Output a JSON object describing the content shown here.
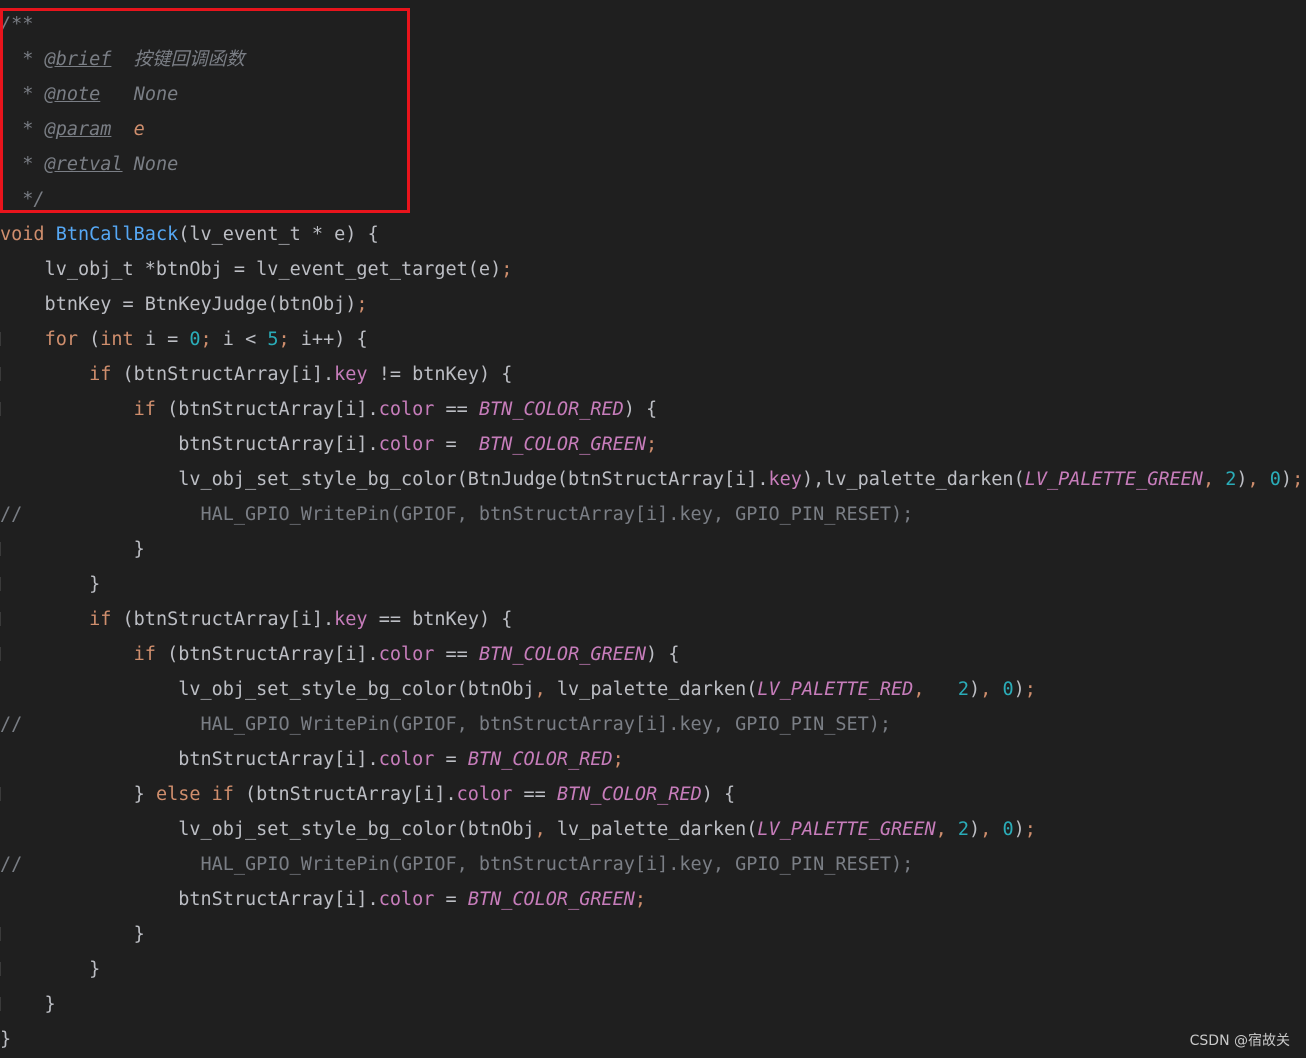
{
  "editor": {
    "lines": [
      {
        "guide": false,
        "tokens": [
          [
            "/**",
            "doc"
          ]
        ]
      },
      {
        "guide": false,
        "tokens": [
          [
            "  * ",
            "doc"
          ],
          [
            "@brief",
            "doctag"
          ],
          [
            "  ",
            "doc"
          ],
          [
            "按键回调函数",
            "doctext"
          ]
        ]
      },
      {
        "guide": false,
        "tokens": [
          [
            "  * ",
            "doc"
          ],
          [
            "@note",
            "doctag"
          ],
          [
            "   ",
            "doc"
          ],
          [
            "None",
            "doctext"
          ]
        ]
      },
      {
        "guide": false,
        "tokens": [
          [
            "  * ",
            "doc"
          ],
          [
            "@param",
            "doctag"
          ],
          [
            "  ",
            "doc"
          ],
          [
            "e",
            "docparam"
          ]
        ]
      },
      {
        "guide": false,
        "tokens": [
          [
            "  * ",
            "doc"
          ],
          [
            "@retval",
            "doctag"
          ],
          [
            " ",
            "doc"
          ],
          [
            "None",
            "doctext"
          ]
        ]
      },
      {
        "guide": false,
        "tokens": [
          [
            "  */",
            "doc"
          ]
        ]
      },
      {
        "guide": false,
        "tokens": [
          [
            "void",
            "kw"
          ],
          [
            " ",
            "plain"
          ],
          [
            "BtnCallBack",
            "fndecl"
          ],
          [
            "(lv_event_t * e) {",
            "plain"
          ]
        ]
      },
      {
        "guide": false,
        "tokens": [
          [
            "    lv_obj_t *btnObj = lv_event_get_target(e)",
            "plain"
          ],
          [
            ";",
            "punct"
          ]
        ]
      },
      {
        "guide": false,
        "tokens": [
          [
            "    btnKey = BtnKeyJudge(btnObj)",
            "plain"
          ],
          [
            ";",
            "punct"
          ]
        ]
      },
      {
        "guide": true,
        "tokens": [
          [
            "    ",
            "plain"
          ],
          [
            "for",
            "kw"
          ],
          [
            " (",
            "plain"
          ],
          [
            "int",
            "kw"
          ],
          [
            " i = ",
            "plain"
          ],
          [
            "0",
            "num"
          ],
          [
            ";",
            "punct"
          ],
          [
            " i < ",
            "plain"
          ],
          [
            "5",
            "num"
          ],
          [
            ";",
            "punct"
          ],
          [
            " i++) {",
            "plain"
          ]
        ]
      },
      {
        "guide": true,
        "tokens": [
          [
            "        ",
            "plain"
          ],
          [
            "if",
            "kw"
          ],
          [
            " (btnStructArray[i].",
            "plain"
          ],
          [
            "key",
            "field"
          ],
          [
            " != btnKey) {",
            "plain"
          ]
        ]
      },
      {
        "guide": true,
        "tokens": [
          [
            "            ",
            "plain"
          ],
          [
            "if",
            "kw"
          ],
          [
            " (btnStructArray[i].",
            "plain"
          ],
          [
            "color",
            "field"
          ],
          [
            " == ",
            "plain"
          ],
          [
            "BTN_COLOR_RED",
            "const"
          ],
          [
            ") {",
            "plain"
          ]
        ]
      },
      {
        "guide": false,
        "tokens": [
          [
            "                btnStructArray[i].",
            "plain"
          ],
          [
            "color",
            "field"
          ],
          [
            " =  ",
            "plain"
          ],
          [
            "BTN_COLOR_GREEN",
            "const"
          ],
          [
            ";",
            "punct"
          ]
        ]
      },
      {
        "guide": false,
        "tokens": [
          [
            "                lv_obj_set_style_bg_color(BtnJudge(btnStructArray[i].",
            "plain"
          ],
          [
            "key",
            "field"
          ],
          [
            "),lv_palette_darken(",
            "plain"
          ],
          [
            "LV_PALETTE_GREEN",
            "const"
          ],
          [
            ", ",
            "punct"
          ],
          [
            "2",
            "num"
          ],
          [
            ")",
            "plain"
          ],
          [
            ", ",
            "punct"
          ],
          [
            "0",
            "num"
          ],
          [
            ")",
            "plain"
          ],
          [
            ";",
            "punct"
          ]
        ]
      },
      {
        "guide": false,
        "tokens": [
          [
            "//                HAL_GPIO_WritePin(GPIOF, btnStructArray[i].key, GPIO_PIN_RESET);",
            "comment"
          ]
        ]
      },
      {
        "guide": true,
        "tokens": [
          [
            "            }",
            "plain"
          ]
        ]
      },
      {
        "guide": true,
        "tokens": [
          [
            "        }",
            "plain"
          ]
        ]
      },
      {
        "guide": true,
        "tokens": [
          [
            "        ",
            "plain"
          ],
          [
            "if",
            "kw"
          ],
          [
            " (btnStructArray[i].",
            "plain"
          ],
          [
            "key",
            "field"
          ],
          [
            " == btnKey) {",
            "plain"
          ]
        ]
      },
      {
        "guide": true,
        "tokens": [
          [
            "            ",
            "plain"
          ],
          [
            "if",
            "kw"
          ],
          [
            " (btnStructArray[i].",
            "plain"
          ],
          [
            "color",
            "field"
          ],
          [
            " == ",
            "plain"
          ],
          [
            "BTN_COLOR_GREEN",
            "const"
          ],
          [
            ") {",
            "plain"
          ]
        ]
      },
      {
        "guide": false,
        "tokens": [
          [
            "                lv_obj_set_style_bg_color(btnObj",
            "plain"
          ],
          [
            ", ",
            "punct"
          ],
          [
            "lv_palette_darken(",
            "plain"
          ],
          [
            "LV_PALETTE_RED",
            "const"
          ],
          [
            ",   ",
            "punct"
          ],
          [
            "2",
            "num"
          ],
          [
            ")",
            "plain"
          ],
          [
            ", ",
            "punct"
          ],
          [
            "0",
            "num"
          ],
          [
            ")",
            "plain"
          ],
          [
            ";",
            "punct"
          ]
        ]
      },
      {
        "guide": false,
        "tokens": [
          [
            "//                HAL_GPIO_WritePin(GPIOF, btnStructArray[i].key, GPIO_PIN_SET);",
            "comment"
          ]
        ]
      },
      {
        "guide": false,
        "tokens": [
          [
            "                btnStructArray[i].",
            "plain"
          ],
          [
            "color",
            "field"
          ],
          [
            " = ",
            "plain"
          ],
          [
            "BTN_COLOR_RED",
            "const"
          ],
          [
            ";",
            "punct"
          ]
        ]
      },
      {
        "guide": true,
        "tokens": [
          [
            "            } ",
            "plain"
          ],
          [
            "else if",
            "kw"
          ],
          [
            " (btnStructArray[i].",
            "plain"
          ],
          [
            "color",
            "field"
          ],
          [
            " == ",
            "plain"
          ],
          [
            "BTN_COLOR_RED",
            "const"
          ],
          [
            ") {",
            "plain"
          ]
        ]
      },
      {
        "guide": false,
        "tokens": [
          [
            "                lv_obj_set_style_bg_color(btnObj",
            "plain"
          ],
          [
            ", ",
            "punct"
          ],
          [
            "lv_palette_darken(",
            "plain"
          ],
          [
            "LV_PALETTE_GREEN",
            "const"
          ],
          [
            ", ",
            "punct"
          ],
          [
            "2",
            "num"
          ],
          [
            ")",
            "plain"
          ],
          [
            ", ",
            "punct"
          ],
          [
            "0",
            "num"
          ],
          [
            ")",
            "plain"
          ],
          [
            ";",
            "punct"
          ]
        ]
      },
      {
        "guide": false,
        "tokens": [
          [
            "//                HAL_GPIO_WritePin(GPIOF, btnStructArray[i].key, GPIO_PIN_RESET);",
            "comment"
          ]
        ]
      },
      {
        "guide": false,
        "tokens": [
          [
            "                btnStructArray[i].",
            "plain"
          ],
          [
            "color",
            "field"
          ],
          [
            " = ",
            "plain"
          ],
          [
            "BTN_COLOR_GREEN",
            "const"
          ],
          [
            ";",
            "punct"
          ]
        ]
      },
      {
        "guide": true,
        "tokens": [
          [
            "            }",
            "plain"
          ]
        ]
      },
      {
        "guide": true,
        "tokens": [
          [
            "        }",
            "plain"
          ]
        ]
      },
      {
        "guide": true,
        "tokens": [
          [
            "    }",
            "plain"
          ]
        ]
      },
      {
        "guide": false,
        "tokens": [
          [
            "}",
            "plain"
          ]
        ]
      }
    ]
  },
  "highlight": {
    "color": "#e8141c"
  },
  "watermark": {
    "text": "CSDN @宿故关"
  }
}
